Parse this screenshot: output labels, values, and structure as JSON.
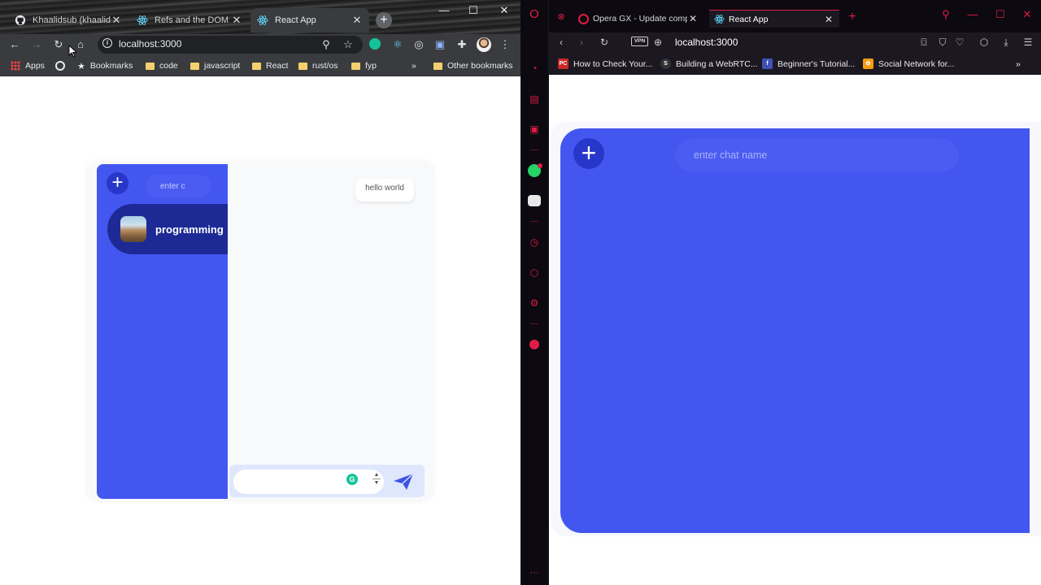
{
  "chrome": {
    "tabs": [
      {
        "label": "Khaalidsub (khaalid s",
        "icon": "github-icon"
      },
      {
        "label": "Refs and the DOM – R",
        "icon": "react-icon"
      },
      {
        "label": "React App",
        "icon": "react-icon",
        "active": true
      }
    ],
    "new_tab": "+",
    "window_controls": {
      "minimize": "—",
      "maximize": "☐",
      "close": "✕"
    },
    "url": "localhost:3000",
    "bookmarks": {
      "apps": "Apps",
      "items": [
        "Bookmarks",
        "code",
        "javascript",
        "React",
        "rust/os",
        "fyp"
      ],
      "overflow": "»",
      "other": "Other bookmarks"
    }
  },
  "left_app": {
    "add_button": "+",
    "chat_name_placeholder": "enter c",
    "chat_items": [
      {
        "label": "programming"
      }
    ],
    "messages": [
      {
        "text": "hello world"
      }
    ],
    "message_input_value": ""
  },
  "opera": {
    "tabs": [
      {
        "label": "Opera GX - Update comple",
        "icon": "opera-icon"
      },
      {
        "label": "React App",
        "icon": "react-icon",
        "active": true
      }
    ],
    "new_tab": "+",
    "vpn_label": "VPN",
    "url": "localhost:3000",
    "bookmarks": [
      {
        "label": "How to Check Your...",
        "icon_text": "PC",
        "color": "#c62828"
      },
      {
        "label": "Building a WebRTC...",
        "icon_text": "S",
        "color": "#333333"
      },
      {
        "label": "Beginner's Tutorial...",
        "icon_text": "f",
        "color": "#3f51b5"
      },
      {
        "label": "Social Network for...",
        "icon_text": "✿",
        "color": "#f39c12"
      }
    ],
    "bookmarks_overflow": "»"
  },
  "right_app": {
    "add_button": "+",
    "chat_name_placeholder": "enter chat name"
  },
  "colors": {
    "app_primary": "#4356f0",
    "app_dark": "#1d2a96",
    "opera_accent": "#e01c45"
  }
}
